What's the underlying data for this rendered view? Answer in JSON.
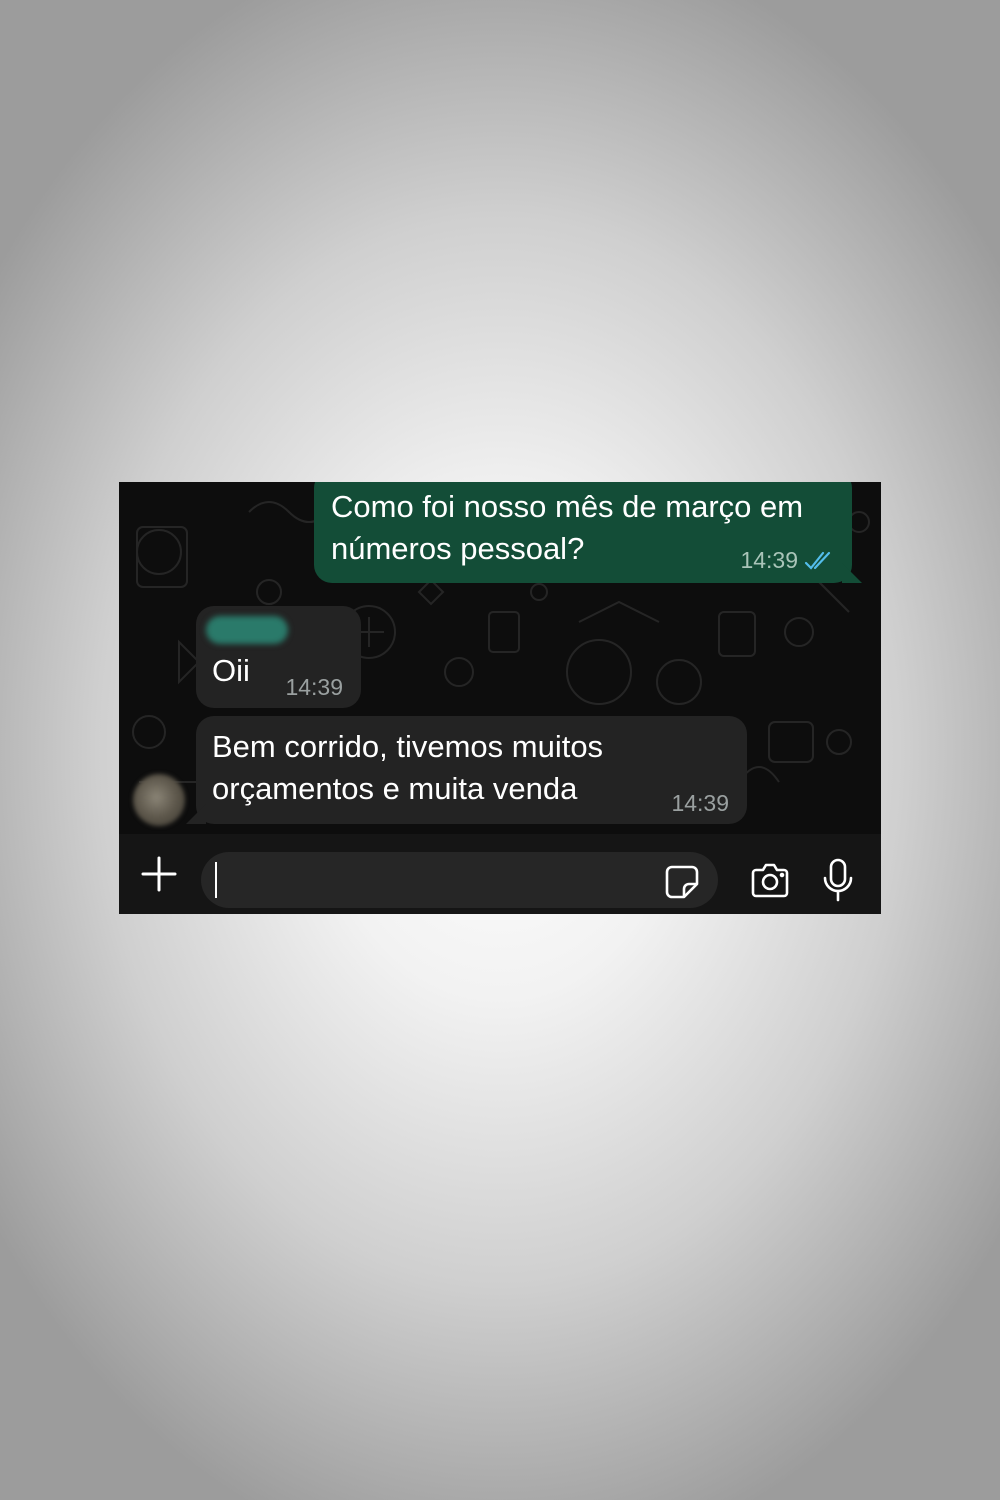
{
  "chat": {
    "messages": [
      {
        "direction": "outgoing",
        "lines": [
          "Como foi nosso mês de março em",
          "números pessoal?"
        ],
        "time": "14:39",
        "status": "read-double-check-icon"
      },
      {
        "direction": "incoming",
        "sender_name_blurred": true,
        "lines": [
          "Oii"
        ],
        "time": "14:39"
      },
      {
        "direction": "incoming",
        "lines": [
          "Bem corrido, tivemos muitos",
          "orçamentos e muita venda"
        ],
        "time": "14:39"
      }
    ]
  },
  "composer": {
    "input_value": "",
    "icons": [
      "plus-icon",
      "sticker-icon",
      "camera-icon",
      "microphone-icon"
    ]
  },
  "colors": {
    "outgoing_bubble": "#134d37",
    "incoming_bubble": "#232323",
    "read_ticks": "#53bdeb",
    "chat_background": "#0d0d0d"
  }
}
